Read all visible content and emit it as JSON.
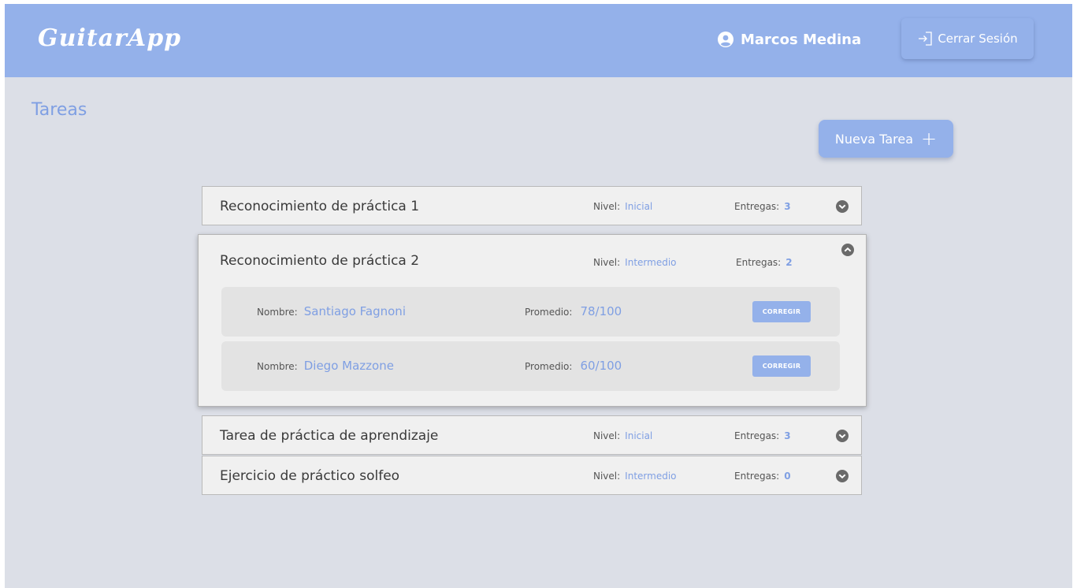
{
  "header": {
    "logo": "GuitarApp",
    "user_name": "Marcos Medina",
    "logout_label": "Cerrar Sesión"
  },
  "page": {
    "title": "Tareas",
    "new_task_label": "Nueva Tarea"
  },
  "labels": {
    "nivel": "Nivel:",
    "entregas": "Entregas:",
    "nombre": "Nombre:",
    "promedio": "Promedio:",
    "corregir": "CORREGIR"
  },
  "tasks": [
    {
      "name": "Reconocimiento de práctica 1",
      "nivel": "Inicial",
      "entregas": "3",
      "expanded": false
    },
    {
      "name": "Reconocimiento de práctica 2",
      "nivel": "Intermedio",
      "entregas": "2",
      "expanded": true,
      "submissions": [
        {
          "nombre": "Santiago Fagnoni",
          "promedio": "78/100"
        },
        {
          "nombre": "Diego Mazzone",
          "promedio": "60/100"
        }
      ]
    },
    {
      "name": "Tarea de práctica de aprendizaje",
      "nivel": "Inicial",
      "entregas": "3",
      "expanded": false
    },
    {
      "name": "Ejercicio de práctico solfeo",
      "nivel": "Intermedio",
      "entregas": "0",
      "expanded": false
    }
  ],
  "icons": {
    "user": "user-circle-icon",
    "logout": "logout-icon",
    "plus": "plus-icon",
    "expand": "chevron-down-icon",
    "collapse": "chevron-up-icon"
  },
  "colors": {
    "header_bg": "#94b1ea",
    "page_bg": "#dcdfe7",
    "accent_text": "#7f9fe3",
    "card_bg": "#f0f0f0"
  }
}
